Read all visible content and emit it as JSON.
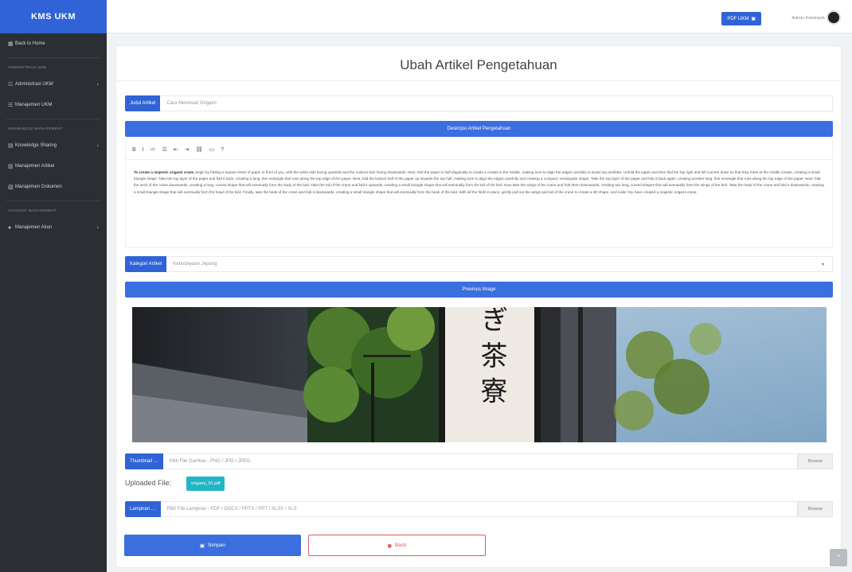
{
  "sidebar": {
    "brand": "KMS UKM",
    "items": [
      {
        "type": "item",
        "icon": "grid-icon",
        "label": "Back to Home",
        "chevron": ""
      },
      {
        "type": "heading",
        "label": "ADMINISTRASI UKM"
      },
      {
        "type": "item",
        "icon": "users-icon",
        "label": "Administrasi UKM",
        "chevron": "›"
      },
      {
        "type": "item",
        "icon": "list-icon",
        "label": "Manajemen UKM",
        "chevron": ""
      },
      {
        "type": "heading",
        "label": "KNOWLEDGE MANAGEMENT"
      },
      {
        "type": "item",
        "icon": "book-icon",
        "label": "Knowledge Sharing",
        "chevron": "›"
      },
      {
        "type": "item",
        "icon": "file-icon",
        "label": "Manajemen Artikel",
        "chevron": ""
      },
      {
        "type": "item",
        "icon": "doc-icon",
        "label": "Manajemen Dokumen",
        "chevron": ""
      },
      {
        "type": "heading",
        "label": "ACCOUNT MANAGEMENT"
      },
      {
        "type": "item",
        "icon": "user-icon",
        "label": "Manajemen Akun",
        "chevron": "›"
      }
    ]
  },
  "topbar": {
    "pdf_button": "PDF UKM",
    "user_name": "Admin Kelompok"
  },
  "page": {
    "title": "Ubah Artikel Pengetahuan",
    "judul_label": "Judul Artikel",
    "judul_value": "Cara Membuat Origami",
    "deskripsi_bar": "Deskripsi Artikel Pengetahuan",
    "toolbar": [
      "B",
      "I",
      "≔",
      "☰",
      "⇤",
      "⇥",
      "⛓",
      "▭",
      "?"
    ],
    "editor_bold": "To create a majestic origami crane,",
    "editor_text": " begin by folding a square sheet of paper in front of you, with the white side facing upwards and the colored side facing downwards. Next, fold the paper in half diagonally to create a crease in the middle, making sure to align the edges carefully to avoid any wrinkles. Unfold the paper and then fold the top right and left corners down so that they meet at the middle crease, creating a small triangle shape. Take the top layer of the paper and fold it back, creating a long, thin rectangle that runs along the top edge of the paper. Next, fold the bottom half of the paper up towards the top half, making sure to align the edges carefully and creating a compact, rectangular shape. Take the top layer of the paper and fold it back again, creating another long, thin rectangle that runs along the top edge of the paper. Next, fold the neck of the crane downwards, creating a long, curved shape that will eventually form the body of the bird. Take the tail of the crane and fold it upwards, creating a small triangle shape that will eventually form the tail of the bird. Now take the wings of the crane and fold them downwards, creating two long, curved shapes that will eventually form the wings of the bird. Take the head of the crane and fold it downwards, creating a small triangle shape that will eventually form the head of the bird. Finally, take the beak of the crane and fold it downwards, creating a small triangle shape that will eventually form the beak of the bird. With all the folds in place, gently pull out the wings and tail of the crane to create a 3D shape, and voila! You have created a majestic origami crane.",
    "kategori_label": "Kategori Artikel",
    "kategori_value": "Kebudayaan Jepang",
    "preview_bar": "Previous Image",
    "photo_sign_text": "ぎ 茶 寮",
    "thumbnail_label": "Thumbnail",
    "thumbnail_placeholder": "Pilih File Gambar - PNG / JPG / JPEG",
    "browse_label": "Browse",
    "uploaded_label": "Uploaded File:",
    "uploaded_file": "origami_10.pdf",
    "lampiran_label": "Lampiran",
    "lampiran_placeholder": "Pilih File Lampiran - PDF / DOCX / PPTX / PPT / XLSX / XLS",
    "save_button": "Simpan",
    "back_button": "Back"
  },
  "colors": {
    "primary": "#2f63d6",
    "sidebar": "#2b2e33",
    "danger": "#e05a5a",
    "info": "#21b6c6"
  }
}
